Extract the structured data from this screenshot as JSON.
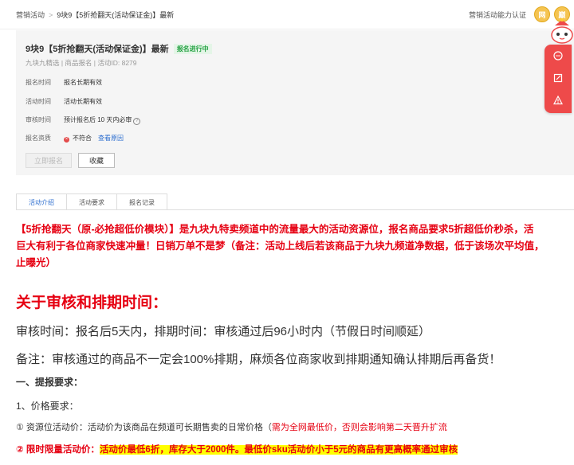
{
  "breadcrumb": {
    "root": "营销活动",
    "current": "9块9【5折抢翻天(活动保证金)】最新"
  },
  "header": {
    "capability_label": "营销活动能力认证",
    "coin1": "网",
    "coin2": "巅"
  },
  "activity": {
    "title": "9块9【5折抢翻天(活动保证金)】最新",
    "status_badge": "报名进行中",
    "subtitle": "九块九精选 | 商品报名 | 活动ID: 8279",
    "rows": [
      {
        "label": "报名时间",
        "value": "报名长期有效"
      },
      {
        "label": "活动时间",
        "value": "活动长期有效"
      },
      {
        "label": "审核时间",
        "value": "预计报名后 10 天内必审"
      },
      {
        "label": "报名资质",
        "value": "不符合",
        "link": "查看原因"
      }
    ],
    "apply_button": "立即报名",
    "favorite_button": "收藏"
  },
  "tabs": [
    "活动介绍",
    "活动要求",
    "报名记录"
  ],
  "content": {
    "intro_line1": "【5折抢翻天（原-必抢超低价模块）】是九块九特卖频道中的流量最大的活动资源位，报名商品要求5折超低价秒杀，活",
    "intro_line2": "巨大有利于各位商家快速冲量！日销万单不是梦（备注：活动上线后若该商品于九块九频道净数据，低于该场次平均值，",
    "intro_line3": "止曝光）",
    "heading": "关于审核和排期时间：",
    "review_line": "审核时间：报名后5天内，排期时间：审核通过后96小时内（节假日时间顺延）",
    "note_line": "备注：审核通过的商品不一定会100%排期，麻烦各位商家收到排期通知确认排期后再备货！",
    "section1": "一、提报要求：",
    "sub1": "1、价格要求：",
    "item1_prefix": "① 资源位活动价：活动价为该商品在频道可长期售卖的日常价格（",
    "item1_red": "需为全网最低价，否则会影响第二天晋升扩流",
    "item2_prefix": "② 限时限量活动价：",
    "item2_highlight": "活动价最低6折，库存大于2000件。最低价sku活动价小于5元的商品有更高概率通过审核"
  }
}
